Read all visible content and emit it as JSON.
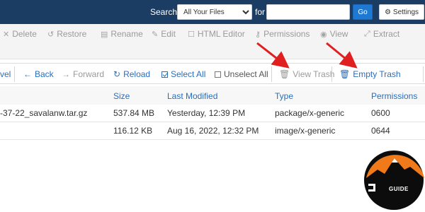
{
  "topbar": {
    "search_label": "Search",
    "search_scope": "All Your Files",
    "for_label": "for",
    "search_value": "",
    "go_label": "Go",
    "settings_label": "Settings",
    "settings_icon": "gear-icon"
  },
  "toolbar": {
    "items": [
      {
        "label": "Delete",
        "icon": "close-icon"
      },
      {
        "label": "Restore",
        "icon": "restore-icon"
      },
      {
        "label": "Rename",
        "icon": "file-icon"
      },
      {
        "label": "Edit",
        "icon": "pencil-icon"
      },
      {
        "label": "HTML Editor",
        "icon": "html-editor-icon"
      },
      {
        "label": "Permissions",
        "icon": "key-icon"
      },
      {
        "label": "View",
        "icon": "eye-icon"
      },
      {
        "label": "Extract",
        "icon": "expand-icon"
      }
    ]
  },
  "nav": {
    "level_partial": "vel",
    "back": "Back",
    "forward": "Forward",
    "reload": "Reload",
    "select_all": "Select All",
    "unselect_all": "Unselect All",
    "view_trash": "View Trash",
    "empty_trash": "Empty Trash"
  },
  "table": {
    "columns": [
      "Size",
      "Last Modified",
      "Type",
      "Permissions"
    ],
    "rows": [
      {
        "name": "-37-22_savalanw.tar.gz",
        "size": "537.84 MB",
        "modified": "Yesterday, 12:39 PM",
        "type": "package/x-generic",
        "perms": "0600"
      },
      {
        "name": "",
        "size": "116.12 KB",
        "modified": "Aug 16, 2022, 12:32 PM",
        "type": "image/x-generic",
        "perms": "0644"
      }
    ]
  },
  "logo": {
    "text": "GUIDE"
  },
  "colors": {
    "header_bg": "#1c3d63",
    "link_blue": "#2a6ebb",
    "arrow_red": "#e02020",
    "logo_orange": "#f07a1a"
  }
}
